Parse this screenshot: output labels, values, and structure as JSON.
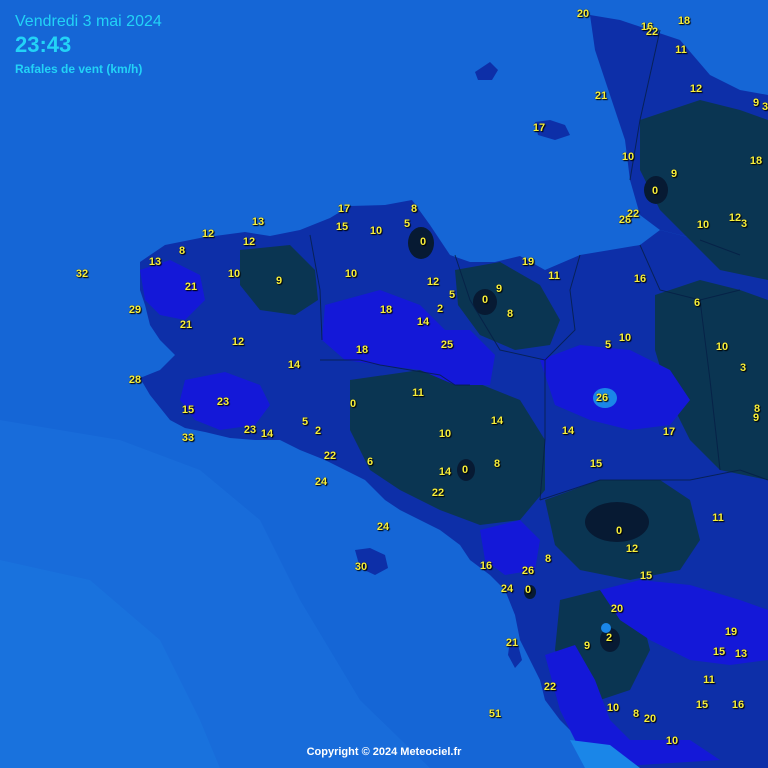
{
  "header": {
    "date": "Vendredi 3 mai 2024",
    "time": "23:43",
    "subtitle": "Rafales de vent (km/h)"
  },
  "footer": {
    "copyright": "Copyright © 2024 Meteociel.fr"
  },
  "colors": {
    "sea": "#1566d6",
    "land_calm": "#0a3552",
    "land_moderate": "#0d2fa8",
    "land_strong": "#1418d8",
    "gust_25": "#1a86e8",
    "label": "#f7ef3b",
    "header_text": "#22d3f7"
  },
  "station_values": [
    "20",
    "16",
    "22",
    "18",
    "11",
    "21",
    "12",
    "9",
    "3",
    "17",
    "10",
    "9",
    "0",
    "18",
    "28",
    "22",
    "12",
    "3",
    "10",
    "17",
    "13",
    "15",
    "10",
    "5",
    "0",
    "12",
    "8",
    "12",
    "8",
    "13",
    "10",
    "9",
    "10",
    "32",
    "19",
    "11",
    "16",
    "21",
    "29",
    "12",
    "2",
    "9",
    "0",
    "5",
    "18",
    "14",
    "8",
    "21",
    "6",
    "12",
    "5",
    "10",
    "18",
    "25",
    "10",
    "28",
    "14",
    "3",
    "23",
    "15",
    "11",
    "8",
    "0",
    "26",
    "17",
    "9",
    "14",
    "33",
    "23",
    "14",
    "5",
    "2",
    "10",
    "14",
    "22",
    "6",
    "14",
    "0",
    "8",
    "15",
    "24",
    "22",
    "11",
    "24",
    "0",
    "12",
    "30",
    "16",
    "26",
    "8",
    "15",
    "24",
    "0",
    "20",
    "2",
    "19",
    "21",
    "9",
    "15",
    "13",
    "11",
    "22",
    "10",
    "8",
    "20",
    "15",
    "16",
    "51",
    "10"
  ]
}
